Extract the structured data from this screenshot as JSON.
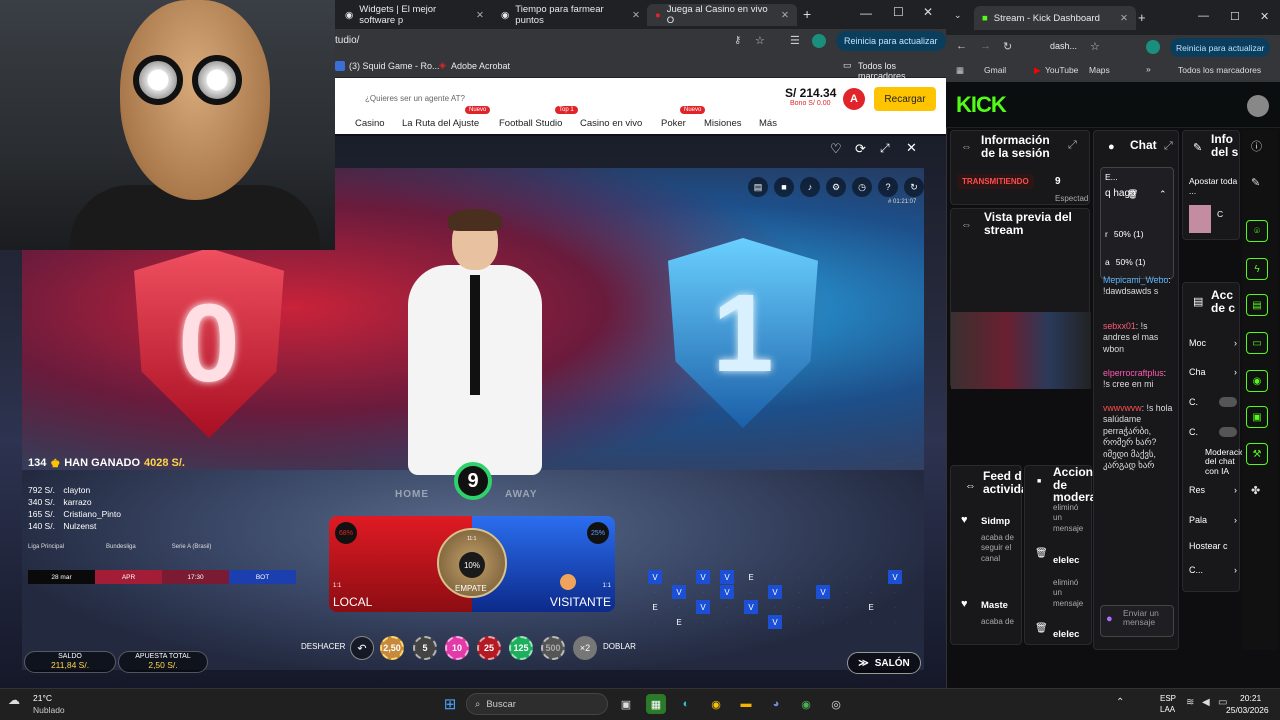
{
  "left_browser": {
    "tabs": [
      {
        "label": "Widgets | El mejor software p"
      },
      {
        "label": "Tiempo para farmear puntos"
      },
      {
        "label": "Juega al Casino en vivo O"
      }
    ],
    "url": "tudio/",
    "update_button": "Reinicia para actualizar",
    "bookmarks": [
      {
        "label": "(3) Squid Game - Ro..."
      },
      {
        "label": "Adobe Acrobat"
      }
    ],
    "all_bookmarks": "Todos los marcadores"
  },
  "casino": {
    "agent_text": "¿Quieres ser un agente AT?",
    "balance": "S/ 214.34",
    "bonus": "Bono S/ 0.00",
    "avatar_letter": "A",
    "recharge": "Recargar",
    "nav": [
      {
        "label": "Casino"
      },
      {
        "label": "La Ruta del Ajuste",
        "badge": "Nuevo"
      },
      {
        "label": "Football Studio",
        "badge": "Top 1"
      },
      {
        "label": "Casino en vivo"
      },
      {
        "label": "Poker",
        "badge": "Nuevo"
      },
      {
        "label": "Misiones"
      },
      {
        "label": "Más"
      }
    ]
  },
  "game": {
    "timecode": "# 01:21:07",
    "home_number": "0",
    "away_number": "1",
    "countdown": "9",
    "table_text_home": "HOME",
    "table_text_away": "AWAY",
    "winners": {
      "count": "134",
      "label": "HAN GANADO",
      "amount": "4028 S/."
    },
    "leaderboard": [
      {
        "amount": "792 S/.",
        "name": "clayton"
      },
      {
        "amount": "340 S/.",
        "name": "karrazo"
      },
      {
        "amount": "165 S/.",
        "name": "Cristiano_Pinto"
      },
      {
        "amount": "140 S/.",
        "name": "Nulzenst"
      }
    ],
    "leagues": [
      "Liga Principal",
      "Bundesliga",
      "Serie A (Brasil)"
    ],
    "match": {
      "date": "28 mar",
      "home": "APR",
      "time": "17:30",
      "away": "BOT"
    },
    "local": {
      "label": "LOCAL",
      "percent": "68%",
      "odds": "1:1"
    },
    "visitor": {
      "label": "VISITANTE",
      "percent": "25%",
      "odds": "1:1"
    },
    "draw": {
      "label": "EMPATE",
      "percent": "10%",
      "odds": "11:1"
    },
    "undo": "DESHACER",
    "double": "DOBLAR",
    "double_icon": "×2",
    "chips": [
      "2,50",
      "5",
      "10",
      "25",
      "125",
      "500"
    ],
    "balance_label": "SALDO",
    "balance_value": "211,84 S/.",
    "total_bet_label": "APUESTA TOTAL",
    "total_bet_value": "2,50 S/.",
    "lobby": "SALÓN",
    "road": [
      [
        "V",
        "",
        "V",
        "V",
        "E",
        "",
        "",
        "",
        "",
        "",
        "V"
      ],
      [
        "",
        "V",
        "",
        "V",
        "",
        "V",
        "",
        "V",
        "",
        "",
        ""
      ],
      [
        "E",
        "",
        "V",
        "",
        "V",
        "",
        "",
        "",
        "",
        "E",
        ""
      ],
      [
        "",
        "E",
        "",
        "",
        "",
        "V",
        "",
        "",
        "",
        "",
        ""
      ]
    ]
  },
  "right_browser": {
    "tab": "Stream - Kick Dashboard",
    "url": "dash...",
    "update_button": "Reinicia para actualizar",
    "bookmarks": [
      {
        "label": "Gmail"
      },
      {
        "label": "YouTube"
      },
      {
        "label": "Maps"
      }
    ],
    "all_bookmarks": "Todos los marcadores"
  },
  "kick": {
    "logo": "KICK",
    "session_title": "Información de la sesión",
    "live_badge": "TRANSMITIENDO",
    "viewers": "9",
    "viewers_label": "Espectad",
    "preview_title": "Vista previa del stream",
    "chat_title": "Chat",
    "info_title": "Info del s",
    "poll": {
      "title": "E...",
      "question": "q hago",
      "options": [
        {
          "letter": "r",
          "value": "50% (1)"
        },
        {
          "letter": "a",
          "value": "50% (1)"
        }
      ]
    },
    "chat": [
      {
        "user": "Mepicami_Webo",
        "text": ": !dawdsawds s"
      },
      {
        "user": "sebxx01",
        "text": ": !s andres el mas wbon"
      },
      {
        "user": "elperrocraftplus",
        "text": ": !s cree en mi"
      },
      {
        "user": "vwwvwvw",
        "text": ": !s hola salúdame perraჭარბი, რომერ ხარ? იმედი მაქვს, კარგად ხარ"
      }
    ],
    "chat_placeholder": "Enviar un mensaje",
    "bets_title": "Apostar toda ...",
    "bets_letter": "C",
    "account_title": "Acc de c",
    "settings": [
      {
        "label": "Moc"
      },
      {
        "label": "Cha"
      },
      {
        "label": "C."
      },
      {
        "label": "C."
      },
      {
        "label": "Moderación del chat con IA"
      },
      {
        "label": "Res"
      },
      {
        "label": "Pala"
      },
      {
        "label": "Hostear c"
      },
      {
        "label": "C..."
      }
    ],
    "feed_title": "Feed d actividad",
    "feed": [
      {
        "user": "Sidmp",
        "action": "acaba de seguir el canal"
      },
      {
        "user": "Maste",
        "action": "acaba de"
      }
    ],
    "mod_title": "Acciones de moderación",
    "mod": [
      {
        "action": "eliminó un mensaje",
        "user": "elelec"
      },
      {
        "action": "eliminó un mensaje",
        "user": "elelec"
      }
    ]
  },
  "taskbar": {
    "weather_temp": "21°C",
    "weather_desc": "Nublado",
    "search": "Buscar",
    "lang": "ESP",
    "lang2": "LAA",
    "time": "20:21",
    "date": "25/03/2026"
  },
  "colors": {
    "kick_green": "#53fc18",
    "local_red": "#c8161d",
    "visitor_blue": "#1a4fd6",
    "recharge_yellow": "#ffc400"
  }
}
